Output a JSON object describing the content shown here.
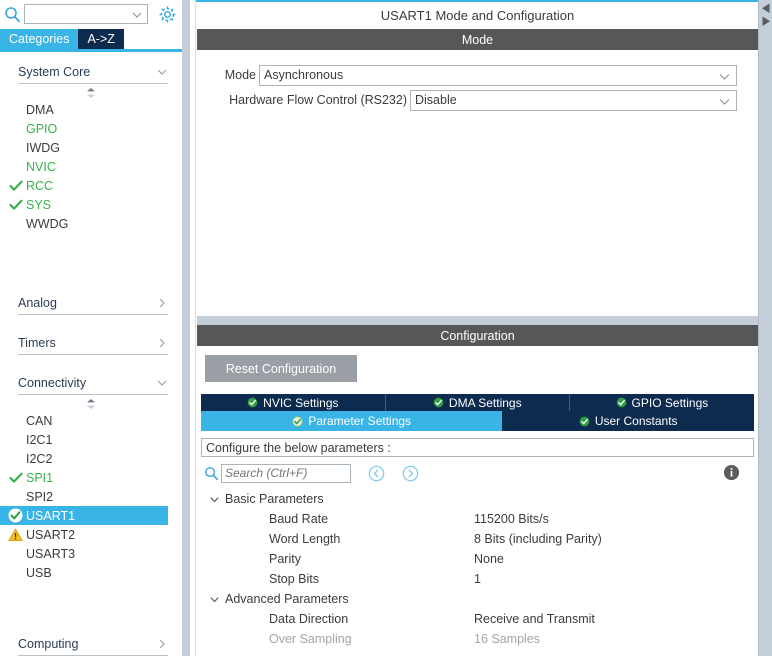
{
  "sidebar": {
    "search": {
      "value": "",
      "placeholder": "",
      "icon": "search-icon"
    },
    "gear": {
      "icon": "gear-icon"
    },
    "tabs": [
      {
        "label": "Categories",
        "selected": true
      },
      {
        "label": "A->Z",
        "selected": false
      }
    ],
    "sections": [
      {
        "title": "System Core",
        "expanded": true,
        "items": [
          {
            "label": "DMA",
            "status": "none",
            "color": "default"
          },
          {
            "label": "GPIO",
            "status": "none",
            "color": "green"
          },
          {
            "label": "IWDG",
            "status": "none",
            "color": "default"
          },
          {
            "label": "NVIC",
            "status": "none",
            "color": "green"
          },
          {
            "label": "RCC",
            "status": "check",
            "color": "green"
          },
          {
            "label": "SYS",
            "status": "check",
            "color": "green"
          },
          {
            "label": "WWDG",
            "status": "none",
            "color": "default"
          }
        ]
      },
      {
        "title": "Analog",
        "expanded": false,
        "items": []
      },
      {
        "title": "Timers",
        "expanded": false,
        "items": []
      },
      {
        "title": "Connectivity",
        "expanded": true,
        "items": [
          {
            "label": "CAN",
            "status": "none",
            "color": "default"
          },
          {
            "label": "I2C1",
            "status": "none",
            "color": "default"
          },
          {
            "label": "I2C2",
            "status": "none",
            "color": "default"
          },
          {
            "label": "SPI1",
            "status": "check",
            "color": "green"
          },
          {
            "label": "SPI2",
            "status": "none",
            "color": "default"
          },
          {
            "label": "USART1",
            "status": "check-selected",
            "color": "default",
            "selected": true
          },
          {
            "label": "USART2",
            "status": "warning",
            "color": "default"
          },
          {
            "label": "USART3",
            "status": "none",
            "color": "default"
          },
          {
            "label": "USB",
            "status": "none",
            "color": "default"
          }
        ]
      },
      {
        "title": "Computing",
        "expanded": false,
        "items": []
      }
    ]
  },
  "main": {
    "title": "USART1 Mode and Configuration",
    "mode_band": "Mode",
    "mode_fields": [
      {
        "label": "Mode",
        "value": "Asynchronous"
      },
      {
        "label": "Hardware Flow Control (RS232)",
        "value": "Disable"
      }
    ],
    "config_band": "Configuration",
    "reset_button": "Reset Configuration",
    "tabs_row1": [
      {
        "label": "NVIC Settings",
        "selected": false,
        "icon": "check-circle-icon"
      },
      {
        "label": "DMA Settings",
        "selected": false,
        "icon": "check-circle-icon"
      },
      {
        "label": "GPIO Settings",
        "selected": false,
        "icon": "check-circle-icon"
      }
    ],
    "tabs_row2": [
      {
        "label": "Parameter Settings",
        "selected": true,
        "icon": "check-circle-icon"
      },
      {
        "label": "User Constants",
        "selected": false,
        "icon": "check-circle-icon"
      }
    ],
    "param_banner": "Configure the below parameters :",
    "param_search": {
      "value": "",
      "placeholder": "Search (Ctrl+F)",
      "icon": "search-icon"
    },
    "nav_prev": "prev-circle-icon",
    "nav_next": "next-circle-icon",
    "info": "info-icon",
    "groups": [
      {
        "title": "Basic Parameters",
        "expanded": true,
        "rows": [
          {
            "name": "Baud Rate",
            "value": "115200 Bits/s",
            "disabled": false
          },
          {
            "name": "Word Length",
            "value": "8 Bits (including Parity)",
            "disabled": false
          },
          {
            "name": "Parity",
            "value": "None",
            "disabled": false
          },
          {
            "name": "Stop Bits",
            "value": "1",
            "disabled": false
          }
        ]
      },
      {
        "title": "Advanced Parameters",
        "expanded": true,
        "rows": [
          {
            "name": "Data Direction",
            "value": "Receive and Transmit",
            "disabled": false
          },
          {
            "name": "Over Sampling",
            "value": "16 Samples",
            "disabled": true
          }
        ]
      }
    ]
  },
  "colors": {
    "accent_blue": "#39b4e6",
    "tab_navy": "#0d2b4e",
    "band_gray": "#555759",
    "status_green": "#37b24d",
    "warning_yellow": "#f5bd20",
    "scrollbar": "#c3ced8"
  }
}
